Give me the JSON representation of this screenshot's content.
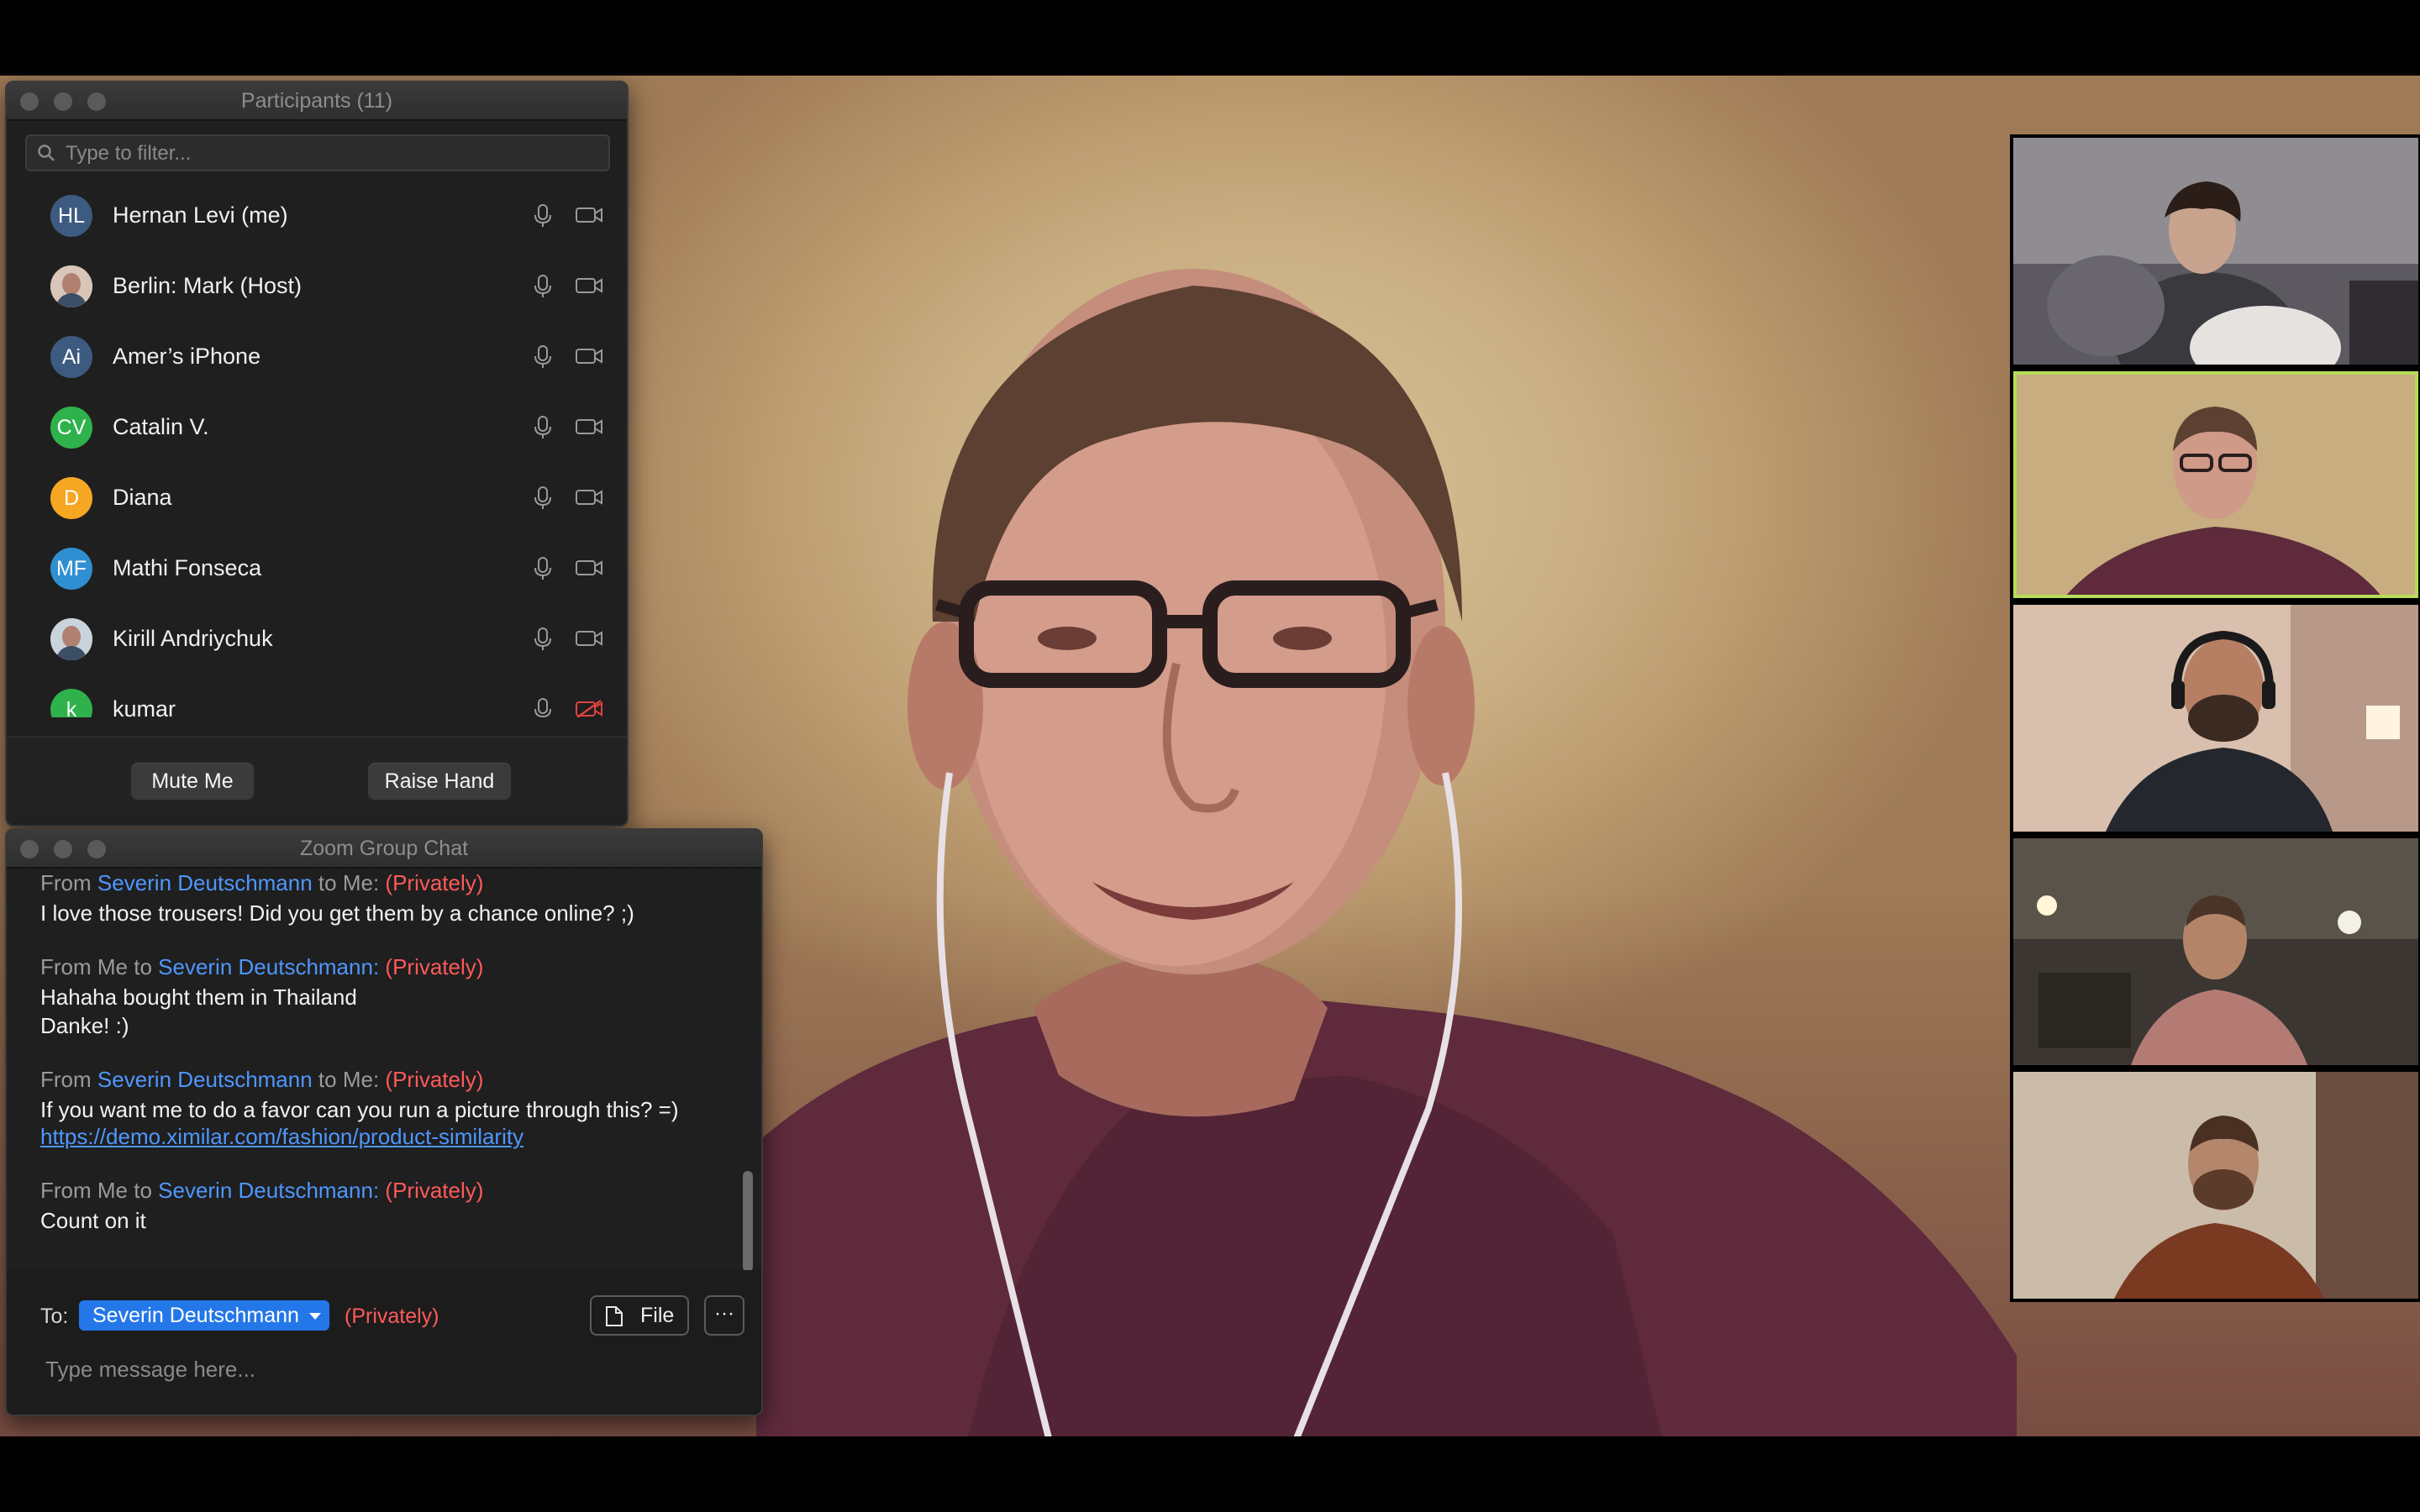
{
  "participants_panel": {
    "title": "Participants (11)",
    "filter_placeholder": "Type to filter...",
    "items": [
      {
        "initials": "HL",
        "name": "Hernan Levi (me)",
        "avatar_color": "#3d5a80",
        "mic": "mic-icon",
        "video": "video-camera-icon"
      },
      {
        "initials": "",
        "name": "Berlin: Mark (Host)",
        "avatar_color": "#d9c6b8",
        "mic": "mic-icon",
        "video": "video-camera-icon"
      },
      {
        "initials": "Ai",
        "name": "Amer’s iPhone",
        "avatar_color": "#3d5a80",
        "mic": "mic-icon",
        "video": "video-camera-icon"
      },
      {
        "initials": "CV",
        "name": "Catalin V.",
        "avatar_color": "#2fb24c",
        "mic": "mic-icon",
        "video": "video-camera-icon"
      },
      {
        "initials": "D",
        "name": "Diana",
        "avatar_color": "#f5a623",
        "mic": "mic-icon",
        "video": "video-camera-icon"
      },
      {
        "initials": "MF",
        "name": "Mathi Fonseca",
        "avatar_color": "#2f8fd1",
        "mic": "mic-icon",
        "video": "video-camera-icon"
      },
      {
        "initials": "",
        "name": "Kirill Andriychuk",
        "avatar_color": "#c8d3db",
        "mic": "mic-icon",
        "video": "video-camera-icon"
      },
      {
        "initials": "k",
        "name": "kumar",
        "avatar_color": "#2fb24c",
        "mic": "mic-icon",
        "video": "video-camera-off-icon"
      }
    ],
    "mute_button": "Mute Me",
    "raise_hand_button": "Raise Hand"
  },
  "chat_panel": {
    "title": "Zoom Group Chat",
    "messages": [
      {
        "from_prefix": "From ",
        "from_name": "Severin Deutschmann",
        "to_text": " to Me: ",
        "privacy": "(Privately)",
        "lines": [
          "I love those trousers! Did you get them by a chance online? ;)"
        ]
      },
      {
        "from_prefix": "From Me to ",
        "from_name": "Severin Deutschmann:",
        "to_text": " ",
        "privacy": "(Privately)",
        "lines": [
          "Hahaha bought them in Thailand",
          "Danke! :)"
        ]
      },
      {
        "from_prefix": "From ",
        "from_name": "Severin Deutschmann",
        "to_text": " to Me: ",
        "privacy": "(Privately)",
        "lines": [
          "If you want me to do a favor can you run a picture through this? =)"
        ],
        "link": "https://demo.ximilar.com/fashion/product-similarity"
      },
      {
        "from_prefix": "From Me to ",
        "from_name": "Severin Deutschmann:",
        "to_text": " ",
        "privacy": "(Privately)",
        "lines": [
          "Count on it"
        ]
      }
    ],
    "to_label": "To:",
    "recipient": "Severin Deutschmann",
    "recipient_privacy": "(Privately)",
    "file_button": "File",
    "more_button": "···",
    "input_placeholder": "Type message here..."
  },
  "colors": {
    "accent_blue": "#2477e8",
    "name_blue": "#4e97ff",
    "private_red": "#ff5a5a",
    "active_speaker_border": "#b6dc5a"
  },
  "video": {
    "thumbnails": [
      "video-participant-1",
      "video-participant-2-active",
      "video-participant-3",
      "video-participant-4",
      "video-participant-5"
    ]
  }
}
